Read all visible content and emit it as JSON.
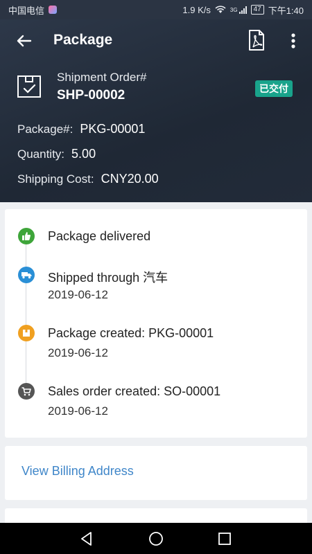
{
  "status_bar": {
    "carrier": "中国电信",
    "speed": "1.9 K/s",
    "network": "3G",
    "battery": "47",
    "time": "下午1:40"
  },
  "appbar": {
    "title": "Package"
  },
  "shipment": {
    "label": "Shipment Order#",
    "number": "SHP-00002",
    "status": "已交付"
  },
  "details": {
    "package_label": "Package#:",
    "package_value": "PKG-00001",
    "quantity_label": "Quantity:",
    "quantity_value": "5.00",
    "shipping_label": "Shipping Cost:",
    "shipping_value": "CNY20.00"
  },
  "timeline": [
    {
      "title": "Package delivered",
      "date": "",
      "icon": "thumbs-up-icon",
      "color": "#3ea53a"
    },
    {
      "title": "Shipped through 汽车",
      "date": "2019-06-12",
      "icon": "truck-icon",
      "color": "#2a8fd6"
    },
    {
      "title": "Package created: PKG-00001",
      "date": "2019-06-12",
      "icon": "package-icon",
      "color": "#f0a020"
    },
    {
      "title": "Sales order created: SO-00001",
      "date": "2019-06-12",
      "icon": "cart-icon",
      "color": "#555555"
    }
  ],
  "billing": {
    "link": "View Billing Address"
  },
  "colors": {
    "header_bg": "#222b39",
    "accent_link": "#3f86c9",
    "badge": "#19a38b"
  }
}
